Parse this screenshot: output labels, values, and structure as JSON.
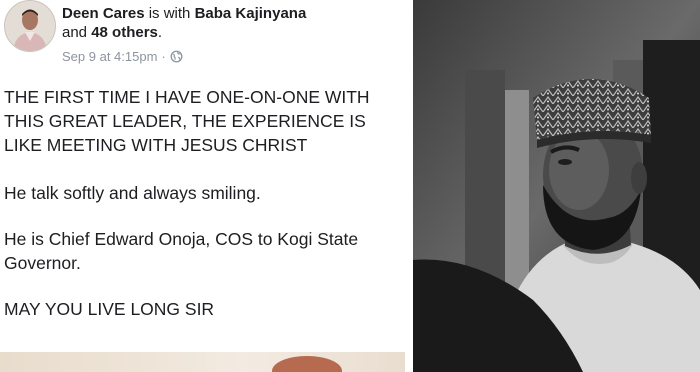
{
  "post": {
    "author": "Deen Cares",
    "with_text": "is with",
    "tagged": "Baba Kajinyana",
    "and_text": "and",
    "others": "48 others",
    "period": ".",
    "timestamp": "Sep 9 at 4:15pm",
    "separator": "·",
    "privacy_icon": "globe-icon",
    "paragraphs": [
      "THE FIRST TIME I HAVE ONE-ON-ONE WITH THIS GREAT LEADER, THE EXPERIENCE IS LIKE MEETING WITH JESUS CHRIST",
      "He talk softly and always smiling.",
      "He is Chief Edward Onoja, COS to Kogi State Governor.",
      "MAY YOU LIVE LONG SIR"
    ]
  },
  "colors": {
    "text": "#1c1e21",
    "meta": "#8d949e"
  }
}
